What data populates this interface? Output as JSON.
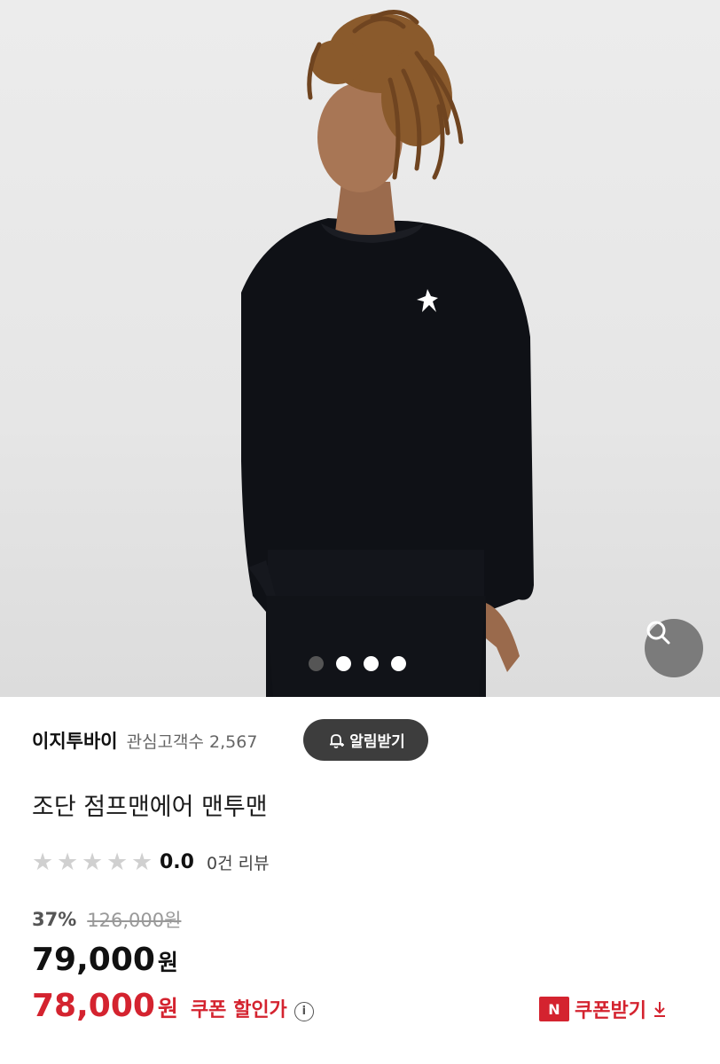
{
  "gallery": {
    "slide_count": 4,
    "active_index": 0,
    "image_desc_icon": "product-photo"
  },
  "store": {
    "name": "이지투바이",
    "fav_label": "관심고객수 2,567",
    "alarm_label": "알림받기"
  },
  "product": {
    "title": "조단 점프맨에어 맨투맨",
    "rating_score": "0.0",
    "rating_value": 0,
    "review_text": "0건 리뷰"
  },
  "pricing": {
    "discount": "37%",
    "original": "126,000원",
    "price": "79,000",
    "price_unit": "원",
    "coupon_price": "78,000",
    "coupon_unit": "원",
    "coupon_label": "쿠폰 할인가",
    "coupon_button": "쿠폰받기",
    "n_badge": "N"
  },
  "colors": {
    "accent_red": "#d4232f",
    "alarm_bg": "#3d3d3d"
  }
}
